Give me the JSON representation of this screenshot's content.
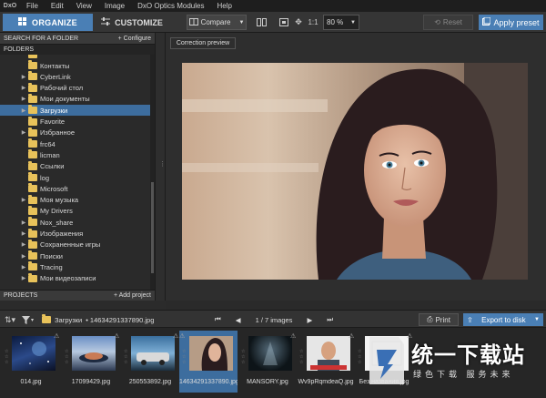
{
  "menu": {
    "logo": "DxO",
    "items": [
      "File",
      "Edit",
      "View",
      "Image",
      "DxO Optics Modules",
      "Help"
    ]
  },
  "toolbar": {
    "organize_label": "ORGANIZE",
    "customize_label": "CUSTOMIZE",
    "compare_label": "Compare",
    "one_to_one": "1:1",
    "zoom_value": "80 %",
    "reset_label": "Reset",
    "apply_preset_label": "Apply preset"
  },
  "left_panel": {
    "search_label": "SEARCH FOR A FOLDER",
    "configure_label": "+ Configure",
    "folders_label": "FOLDERS",
    "projects_label": "PROJECTS",
    "add_project_label": "+ Add project",
    "tree": [
      {
        "label": "Контакты",
        "expandable": false,
        "selected": false
      },
      {
        "label": "CyberLink",
        "expandable": true,
        "selected": false
      },
      {
        "label": "Рабочий стол",
        "expandable": true,
        "selected": false
      },
      {
        "label": "Мои документы",
        "expandable": true,
        "selected": false
      },
      {
        "label": "Загрузки",
        "expandable": true,
        "selected": true
      },
      {
        "label": "Favorite",
        "expandable": false,
        "selected": false
      },
      {
        "label": "Избранное",
        "expandable": true,
        "selected": false
      },
      {
        "label": "frc64",
        "expandable": false,
        "selected": false
      },
      {
        "label": "licman",
        "expandable": false,
        "selected": false
      },
      {
        "label": "Ссылки",
        "expandable": false,
        "selected": false
      },
      {
        "label": "log",
        "expandable": false,
        "selected": false
      },
      {
        "label": "Microsoft",
        "expandable": false,
        "selected": false
      },
      {
        "label": "Моя музыка",
        "expandable": true,
        "selected": false
      },
      {
        "label": "My Drivers",
        "expandable": false,
        "selected": false
      },
      {
        "label": "Nox_share",
        "expandable": true,
        "selected": false
      },
      {
        "label": "Изображения",
        "expandable": true,
        "selected": false
      },
      {
        "label": "Сохраненные игры",
        "expandable": true,
        "selected": false
      },
      {
        "label": "Поиски",
        "expandable": true,
        "selected": false
      },
      {
        "label": "Tracing",
        "expandable": true,
        "selected": false
      },
      {
        "label": "Мои видеозаписи",
        "expandable": true,
        "selected": false
      }
    ]
  },
  "viewer": {
    "correction_preview_label": "Correction preview"
  },
  "filmbar": {
    "breadcrumb_folder": "Загрузки",
    "breadcrumb_file": "• 14634291337890.jpg",
    "pager": "1 / 7",
    "pager_unit": "images",
    "print_label": "Print",
    "export_label": "Export to disk"
  },
  "filmstrip": [
    {
      "label": "014.jpg",
      "selected": false
    },
    {
      "label": "17099429.jpg",
      "selected": false
    },
    {
      "label": "250553892.jpg",
      "selected": false
    },
    {
      "label": "14634291337890.jpg",
      "selected": true
    },
    {
      "label": "MANSORY.jpg",
      "selected": false
    },
    {
      "label": "Wv9pRqmdeaQ.jpg",
      "selected": false
    },
    {
      "label": "Без названия.jpg",
      "selected": false
    }
  ],
  "watermark": {
    "title": "统一下载站",
    "subtitle": "绿色下载  服务未来"
  },
  "colors": {
    "accent": "#4a7fb5",
    "selection": "#3d6d9e",
    "folder": "#e8c25a"
  }
}
